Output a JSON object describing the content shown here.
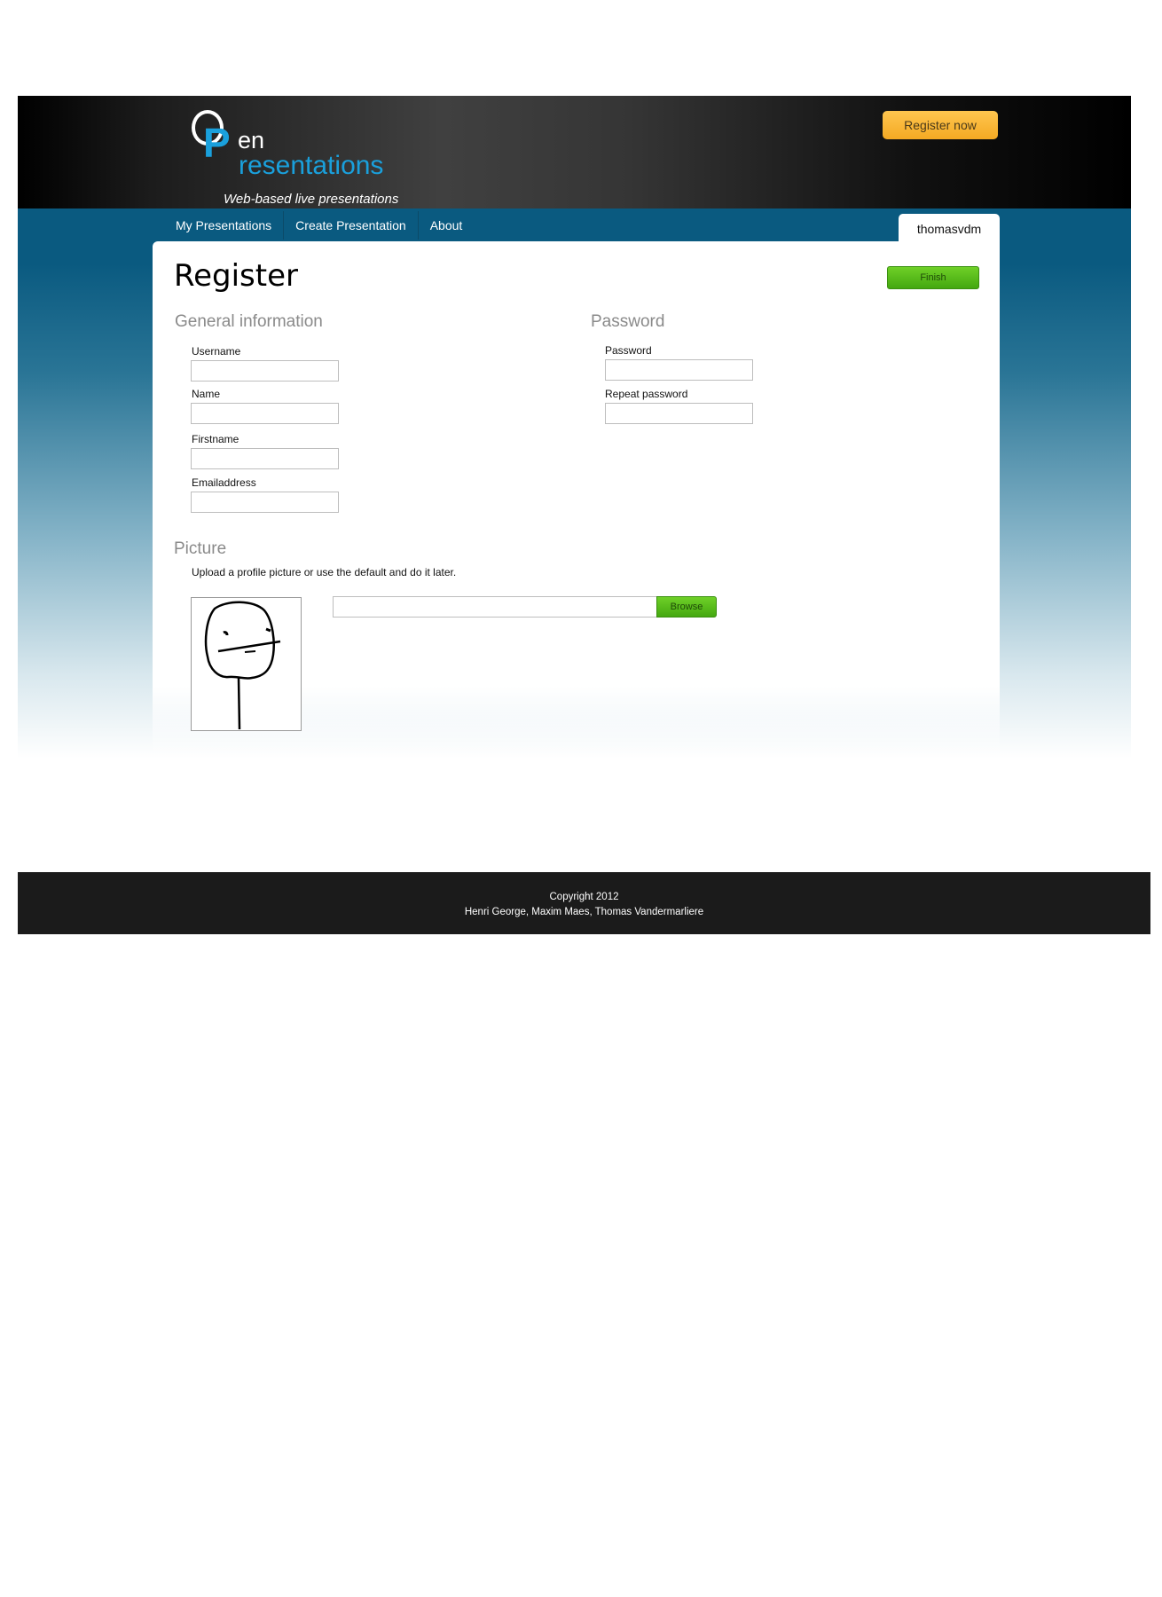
{
  "header": {
    "logo": {
      "letter_o": "O",
      "letter_p": "P",
      "text_en": "en",
      "text_rest": "resentations",
      "tagline": "Web-based live presentations"
    },
    "register_now_label": "Register now"
  },
  "nav": {
    "items": [
      {
        "label": "My Presentations"
      },
      {
        "label": "Create Presentation"
      },
      {
        "label": "About"
      }
    ],
    "user_tab": "thomasvdm"
  },
  "page": {
    "title": "Register",
    "finish_label": "Finish",
    "general": {
      "title": "General information",
      "fields": [
        {
          "label": "Username",
          "value": ""
        },
        {
          "label": "Name",
          "value": ""
        },
        {
          "label": "Firstname",
          "value": ""
        },
        {
          "label": "Emailaddress",
          "value": ""
        }
      ]
    },
    "password": {
      "title": "Password",
      "fields": [
        {
          "label": "Password",
          "value": ""
        },
        {
          "label": "Repeat password",
          "value": ""
        }
      ]
    },
    "picture": {
      "title": "Picture",
      "description": "Upload a profile picture or use the default and do it later.",
      "file_value": "",
      "browse_label": "Browse"
    }
  },
  "footer": {
    "copyright": "Copyright 2012",
    "authors": "Henri George, Maxim Maes, Thomas Vandermarliere"
  },
  "colors": {
    "brand_blue": "#1aa0dc",
    "band_blue": "#0a5a80",
    "accent_orange": "#f4a923",
    "button_green": "#44a810",
    "footer_bg": "#1b1b1b"
  }
}
